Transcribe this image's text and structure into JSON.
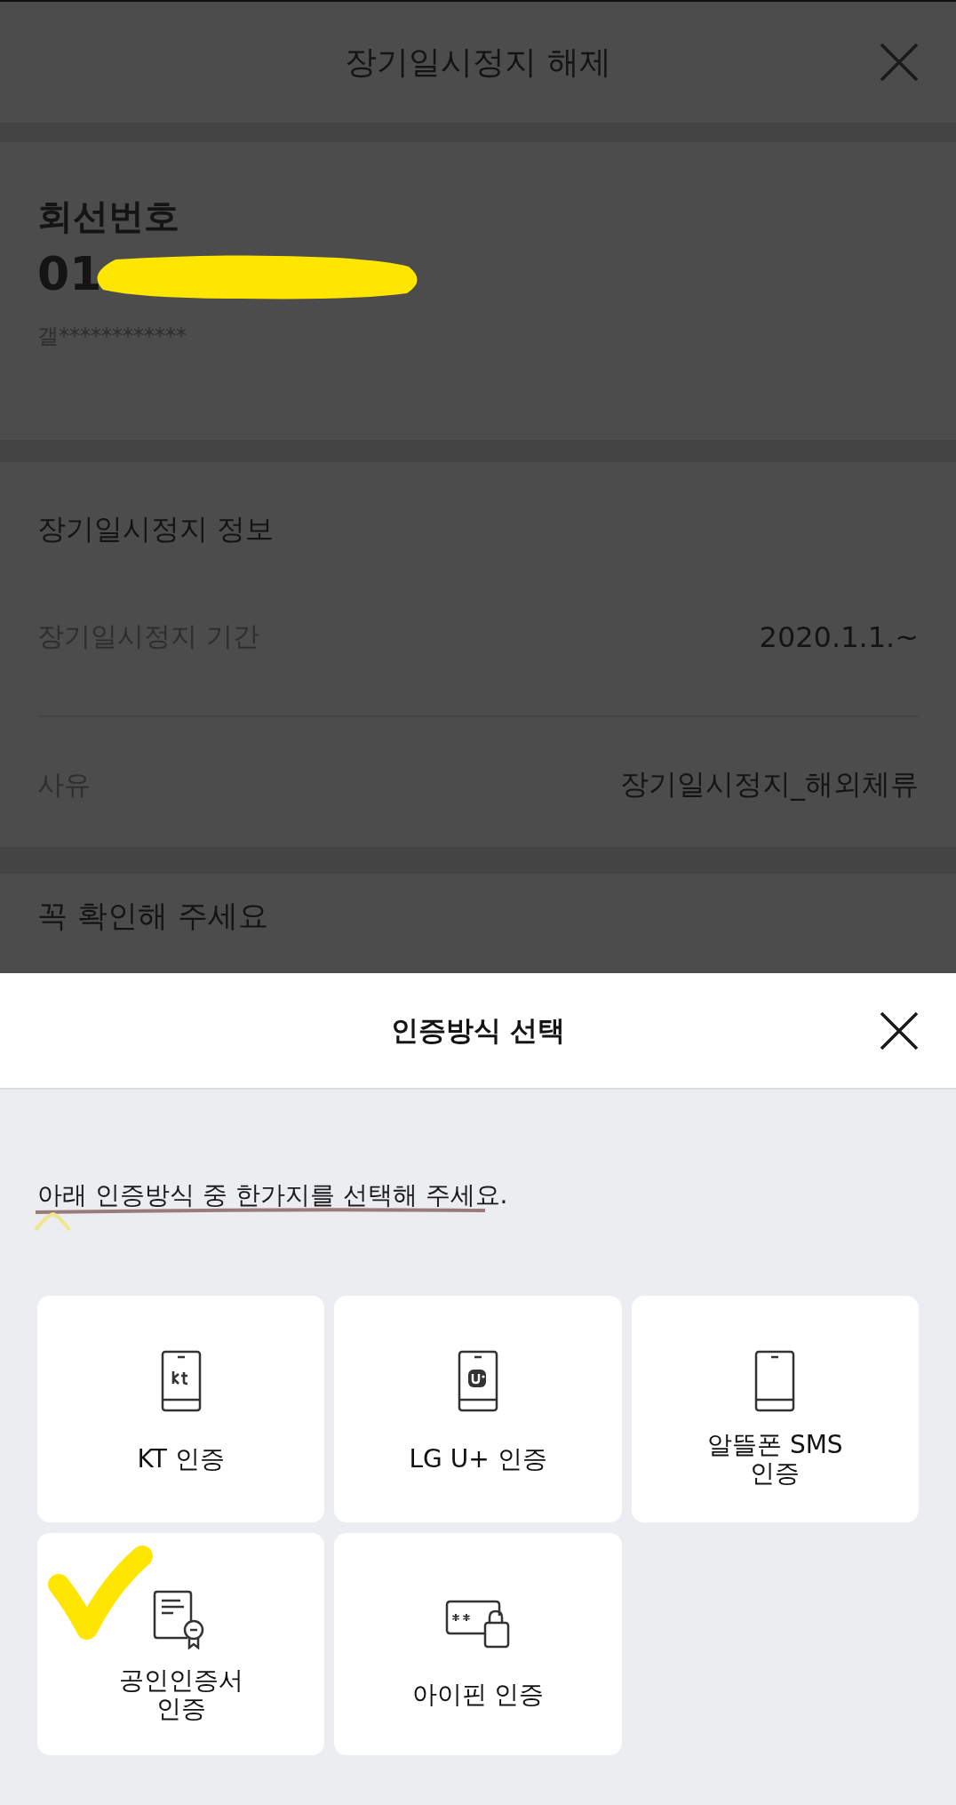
{
  "page": {
    "title": "장기일시정지 해제"
  },
  "line_card": {
    "label": "회선번호",
    "number": "01",
    "number_redacted": true,
    "device": "갤************"
  },
  "info": {
    "title": "장기일시정지 정보",
    "rows": [
      {
        "label": "장기일시정지 기간",
        "value": "2020.1.1.~"
      },
      {
        "label": "사유",
        "value": "장기일시정지_해외체류"
      }
    ]
  },
  "notice": {
    "title": "꼭 확인해 주세요"
  },
  "sheet": {
    "title": "인증방식 선택",
    "instruction": "아래 인증방식 중 한가지를 선택해 주세요.",
    "instruction_underlined": true,
    "options": [
      {
        "kind": "kt",
        "label": "KT 인증",
        "marked": false
      },
      {
        "kind": "lgu",
        "label": "LG U+ 인증",
        "marked": false
      },
      {
        "kind": "phone",
        "label": "알뜰폰 SMS\n인증",
        "marked": false
      },
      {
        "kind": "certificate",
        "label": "공인인증서\n인증",
        "marked": true
      },
      {
        "kind": "ipin",
        "label": "아이핀 인증",
        "marked": false
      }
    ]
  }
}
